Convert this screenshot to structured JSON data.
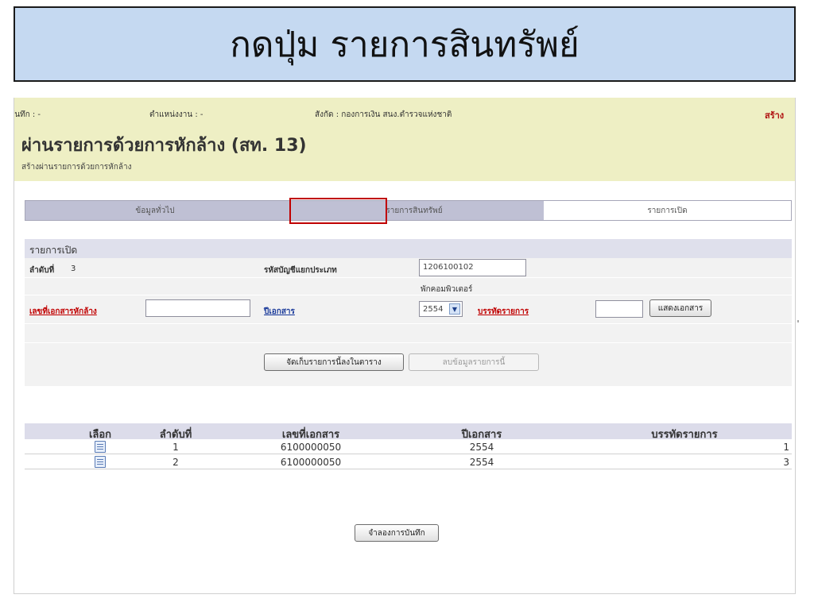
{
  "banner": {
    "title": "กดปุ่ม รายการสินทรัพย์"
  },
  "info_bar": {
    "recorder": "ผู้บันทึก : -",
    "position": "ตำแหน่งงาน : -",
    "affiliation": "สังกัด : กองการเงิน สนง.ตำรวจแห่งชาติ",
    "create_link": "สร้าง"
  },
  "form": {
    "title": "ผ่านรายการด้วยการหักล้าง (สท. 13)",
    "subtitle": "สร้างผ่านรายการด้วยการหักล้าง"
  },
  "tabs": [
    {
      "label": "ข้อมูลทั่วไป"
    },
    {
      "label": "รายการสินทรัพย์"
    },
    {
      "label": "รายการเปิด"
    }
  ],
  "panel": {
    "title": "รายการเปิด",
    "seq_label": "ลำดับที่",
    "seq_value": "3",
    "account_label": "รหัสบัญชีแยกประเภท",
    "account_value": "1206100102",
    "account_desc": "พักคอมพิวเตอร์",
    "clearing_doc_label": "เลขที่เอกสารหักล้าง",
    "clearing_doc_value": "",
    "doc_year_label": "ปีเอกสาร",
    "doc_year_value": "2554",
    "line_item_label": "บรรทัดรายการ",
    "line_item_value": "",
    "show_doc_button": "แสดงเอกสาร",
    "store_button": "จัดเก็บรายการนี้ลงในตาราง",
    "delete_button": "ลบข้อมูลรายการนี้"
  },
  "table": {
    "columns": [
      "เลือก",
      "ลำดับที่",
      "เลขที่เอกสาร",
      "ปีเอกสาร",
      "บรรทัดรายการ"
    ],
    "rows": [
      {
        "icon": "document-icon",
        "seq": "1",
        "doc_no": "6100000050",
        "year": "2554",
        "line": "1"
      },
      {
        "icon": "document-icon",
        "seq": "2",
        "doc_no": "6100000050",
        "year": "2554",
        "line": "3"
      }
    ]
  },
  "footer": {
    "simulate_button": "จำลองการบันทึก"
  },
  "colors": {
    "banner_bg": "#c5d9f1",
    "header_bg": "#eeefc4",
    "highlight": "#c00000",
    "link_red": "#c00000",
    "link_blue": "#1a3a9a"
  }
}
